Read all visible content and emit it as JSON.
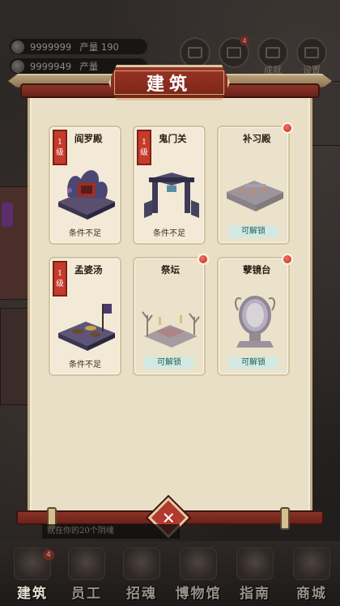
{
  "resources": [
    {
      "icon": "coin-icon",
      "amount": "9999999",
      "label": "产量 190"
    },
    {
      "icon": "gem-icon",
      "amount": "9999949",
      "label": "产量"
    }
  ],
  "top_buttons": [
    {
      "icon": "lotus-icon",
      "label": ""
    },
    {
      "icon": "book-icon",
      "label": "",
      "badge": "4"
    },
    {
      "icon": "scroll-icon",
      "label": "成就"
    },
    {
      "icon": "gear-icon",
      "label": "设置"
    }
  ],
  "dialog": {
    "title": "建筑",
    "buildings": [
      {
        "name": "阎罗殿",
        "level_num": "1",
        "level_unit": "级",
        "status": "条件不足",
        "locked": false,
        "red_dot": false
      },
      {
        "name": "鬼门关",
        "level_num": "1",
        "level_unit": "级",
        "status": "条件不足",
        "locked": false,
        "red_dot": false
      },
      {
        "name": "补习殿",
        "level_num": "",
        "level_unit": "",
        "status": "可解锁",
        "locked": true,
        "red_dot": true
      },
      {
        "name": "孟婆汤",
        "level_num": "1",
        "level_unit": "级",
        "status": "条件不足",
        "locked": false,
        "red_dot": false
      },
      {
        "name": "祭坛",
        "level_num": "",
        "level_unit": "",
        "status": "可解锁",
        "locked": true,
        "red_dot": true
      },
      {
        "name": "孽镜台",
        "level_num": "",
        "level_unit": "",
        "status": "可解锁",
        "locked": true,
        "red_dot": true
      }
    ],
    "close_icon": "close-icon"
  },
  "tip_text": "就在你的20个阴魂",
  "nav": [
    {
      "label": "建筑",
      "icon": "building-icon",
      "badge": "4",
      "active": true
    },
    {
      "label": "员工",
      "icon": "staff-icon",
      "active": false
    },
    {
      "label": "招魂",
      "icon": "summon-icon",
      "active": false
    },
    {
      "label": "博物馆",
      "icon": "museum-icon",
      "active": false
    },
    {
      "label": "指南",
      "icon": "guide-icon",
      "active": false
    },
    {
      "label": "商城",
      "icon": "shop-icon",
      "active": false
    }
  ],
  "colors": {
    "accent_red": "#c53b2c",
    "unlock_bg": "#d4e8e2",
    "unlock_text": "#1e6154",
    "panel": "#e9dfc6"
  }
}
